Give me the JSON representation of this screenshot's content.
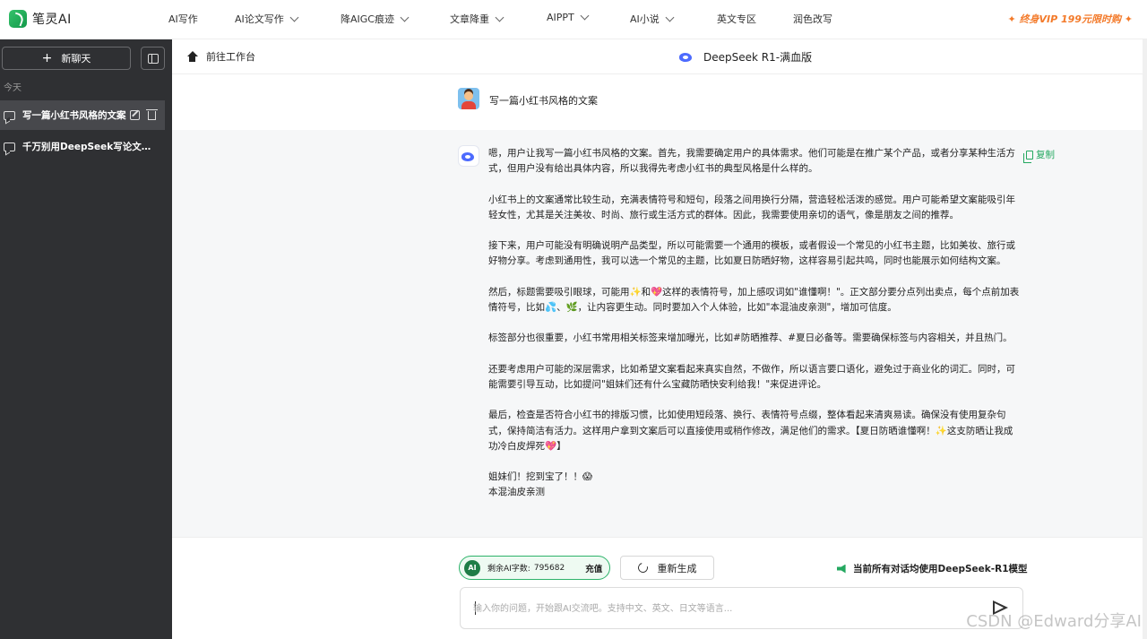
{
  "brand": {
    "name": "笔灵AI"
  },
  "nav": {
    "items": [
      {
        "label": "AI写作",
        "has_dropdown": false
      },
      {
        "label": "AI论文写作",
        "has_dropdown": true
      },
      {
        "label": "降AIGC痕迹",
        "has_dropdown": true
      },
      {
        "label": "文章降重",
        "has_dropdown": true
      },
      {
        "label": "AIPPT",
        "has_dropdown": true
      },
      {
        "label": "AI小说",
        "has_dropdown": true
      },
      {
        "label": "英文专区",
        "has_dropdown": false
      },
      {
        "label": "润色改写",
        "has_dropdown": false
      }
    ],
    "vip": "✦ 终身VIP 199元限时购 ✦"
  },
  "sidebar": {
    "new_chat": "新聊天",
    "section_today": "今天",
    "conversations": [
      {
        "label": "写一篇小红书风格的文案",
        "active": true
      },
      {
        "label": "千万别用DeepSeek写论文，...",
        "active": false
      }
    ]
  },
  "header": {
    "workbench": "前往工作台",
    "model": "DeepSeek R1-满血版"
  },
  "chat": {
    "user_message": "写一篇小红书风格的文案",
    "copy_label": "复制",
    "answer_paragraphs": [
      "嗯，用户让我写一篇小红书风格的文案。首先，我需要确定用户的具体需求。他们可能是在推广某个产品，或者分享某种生活方式，但用户没有给出具体内容，所以我得先考虑小红书的典型风格是什么样的。",
      "小红书上的文案通常比较生动，充满表情符号和短句，段落之间用换行分隔，营造轻松活泼的感觉。用户可能希望文案能吸引年轻女性，尤其是关注美妆、时尚、旅行或生活方式的群体。因此，我需要使用亲切的语气，像是朋友之间的推荐。",
      "接下来，用户可能没有明确说明产品类型，所以可能需要一个通用的模板，或者假设一个常见的小红书主题，比如美妆、旅行或好物分享。考虑到通用性，我可以选一个常见的主题，比如夏日防晒好物，这样容易引起共鸣，同时也能展示如何结构文案。",
      "然后，标题需要吸引眼球，可能用✨和💖这样的表情符号，加上感叹词如\"谁懂啊！\"。正文部分要分点列出卖点，每个点前加表情符号，比如💦、🌿，让内容更生动。同时要加入个人体验，比如\"本混油皮亲测\"，增加可信度。",
      "标签部分也很重要，小红书常用相关标签来增加曝光，比如#防晒推荐、#夏日必备等。需要确保标签与内容相关，并且热门。",
      "还要考虑用户可能的深层需求，比如希望文案看起来真实自然，不做作，所以语言要口语化，避免过于商业化的词汇。同时，可能需要引导互动，比如提问\"姐妹们还有什么宝藏防晒快安利给我！\"来促进评论。",
      "最后，检查是否符合小红书的排版习惯，比如使用短段落、换行、表情符号点缀，整体看起来清爽易读。确保没有使用复杂句式，保持简洁有活力。这样用户拿到文案后可以直接使用或稍作修改，满足他们的需求。【夏日防晒谁懂啊！✨这支防晒让我成功冷白皮焊死💖】"
    ],
    "answer_tail": [
      "姐妹们！挖到宝了！！😱",
      "本混油皮亲测"
    ]
  },
  "footer": {
    "quota_badge": "AI",
    "quota_label": "剩余AI字数:",
    "quota_value": "795682",
    "recharge": "充值",
    "regenerate": "重新生成",
    "model_note": "当前所有对话均使用DeepSeek-R1模型",
    "input_placeholder": "输入你的问题，开始跟AI交流吧。支持中文、英文、日文等语言..."
  },
  "watermark": "CSDN @Edward分享AI",
  "colors": {
    "accent_green": "#24a860",
    "sidebar_bg": "#2f3033",
    "vip_orange": "#f37a2a",
    "deepseek_blue": "#4d6bfe"
  }
}
